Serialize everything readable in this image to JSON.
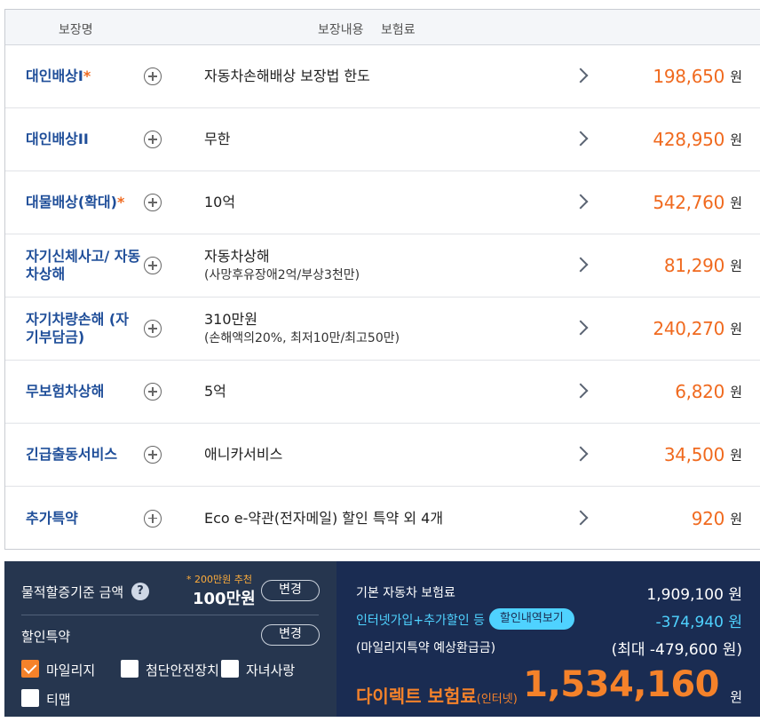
{
  "header": {
    "col_name": "보장명",
    "col_desc": "보장내용",
    "col_premium": "보험료"
  },
  "rows": [
    {
      "name": "대인배상I",
      "star": "*",
      "desc": "자동차손해배상 보장법 한도",
      "sub": "",
      "amount": "198,650",
      "unit": "원"
    },
    {
      "name": "대인배상II",
      "star": "",
      "desc": "무한",
      "sub": "",
      "amount": "428,950",
      "unit": "원"
    },
    {
      "name": "대물배상(확대)",
      "star": "*",
      "desc": "10억",
      "sub": "",
      "amount": "542,760",
      "unit": "원"
    },
    {
      "name": "자기신체사고/ 자동차상해",
      "star": "",
      "desc": "자동차상해",
      "sub": "(사망후유장애2억/부상3천만)",
      "amount": "81,290",
      "unit": "원"
    },
    {
      "name": "자기차량손해 (자기부담금)",
      "star": "",
      "desc": "310만원",
      "sub": "(손해액의20%, 최저10만/최고50만)",
      "amount": "240,270",
      "unit": "원"
    },
    {
      "name": "무보험차상해",
      "star": "",
      "desc": "5억",
      "sub": "",
      "amount": "6,820",
      "unit": "원"
    },
    {
      "name": "긴급출동서비스",
      "star": "",
      "desc": "애니카서비스",
      "sub": "",
      "amount": "34,500",
      "unit": "원"
    },
    {
      "name": "추가특약",
      "star": "",
      "desc": "Eco e-약관(전자메일) 할인 특약 외 4개",
      "sub": "",
      "amount": "920",
      "unit": "원"
    }
  ],
  "summary": {
    "property_label": "물적할증기준 금액",
    "help_icon": "?",
    "recommend": "* 200만원 추천",
    "property_amount": "100만원",
    "change_label": "변경",
    "discount_label": "할인특약",
    "checkboxes": [
      {
        "label": "마일리지",
        "checked": true
      },
      {
        "label": "첨단안전장치",
        "checked": false
      },
      {
        "label": "자녀사랑",
        "checked": false
      },
      {
        "label": "티맵",
        "checked": false
      }
    ],
    "base_label": "기본 자동차 보험료",
    "base_value": "1,909,100 원",
    "internet_label": "인터넷가입+추가할인 등",
    "discount_detail_btn": "할인내역보기",
    "internet_value": "-374,940 원",
    "mileage_label": "(마일리지특약 예상환급금)",
    "mileage_value": "(최대 -479,600 원)",
    "direct_label": "다이렉트 보험료",
    "direct_small": "(인터넷)",
    "total": "1,534,160",
    "total_unit": "원"
  },
  "colors": {
    "accent_orange": "#f06a1f",
    "name_blue": "#1f4e99",
    "panel_left": "#26364f",
    "panel_right": "#1a2c52",
    "cyan": "#4fd2ff"
  }
}
